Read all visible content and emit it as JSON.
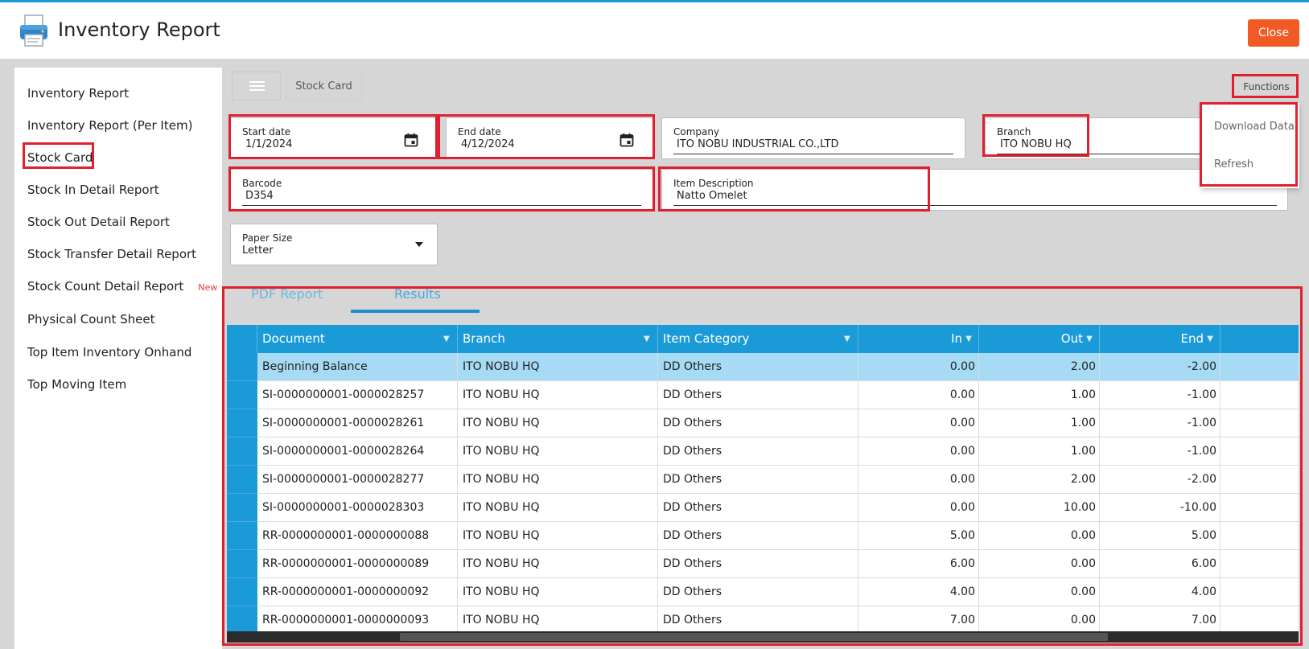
{
  "header": {
    "title": "Inventory Report",
    "close_label": "Close"
  },
  "sidebar": {
    "items": [
      {
        "label": "Inventory Report"
      },
      {
        "label": "Inventory Report (Per Item)"
      },
      {
        "label": "Stock Card"
      },
      {
        "label": "Stock In Detail Report"
      },
      {
        "label": "Stock Out Detail Report"
      },
      {
        "label": "Stock Transfer Detail Report"
      },
      {
        "label": "Stock Count Detail Report",
        "badge": "New"
      },
      {
        "label": "Physical Count Sheet"
      },
      {
        "label": "Top Item Inventory Onhand"
      },
      {
        "label": "Top Moving Item"
      }
    ]
  },
  "toolbar": {
    "breadcrumb": "Stock Card",
    "functions_label": "Functions"
  },
  "functions_menu": {
    "download": "Download Data",
    "refresh": "Refresh"
  },
  "form": {
    "start_date": {
      "label": "Start date",
      "value": "1/1/2024"
    },
    "end_date": {
      "label": "End date",
      "value": "4/12/2024"
    },
    "company": {
      "label": "Company",
      "value": "ITO NOBU INDUSTRIAL CO.,LTD"
    },
    "branch": {
      "label": "Branch",
      "value": "ITO NOBU HQ"
    },
    "barcode": {
      "label": "Barcode",
      "value": "D354"
    },
    "item_description": {
      "label": "Item Description",
      "value": "Natto Omelet"
    },
    "paper_size": {
      "label": "Paper Size",
      "value": "Letter"
    }
  },
  "tabs": [
    {
      "label": "PDF Report"
    },
    {
      "label": "Results"
    }
  ],
  "table": {
    "columns": [
      "Document",
      "Branch",
      "Item Category",
      "In",
      "Out",
      "End"
    ],
    "rows": [
      [
        "Beginning Balance",
        "ITO NOBU HQ",
        "DD Others",
        "0.00",
        "2.00",
        "-2.00"
      ],
      [
        "SI-0000000001-0000028257",
        "ITO NOBU HQ",
        "DD Others",
        "0.00",
        "1.00",
        "-1.00"
      ],
      [
        "SI-0000000001-0000028261",
        "ITO NOBU HQ",
        "DD Others",
        "0.00",
        "1.00",
        "-1.00"
      ],
      [
        "SI-0000000001-0000028264",
        "ITO NOBU HQ",
        "DD Others",
        "0.00",
        "1.00",
        "-1.00"
      ],
      [
        "SI-0000000001-0000028277",
        "ITO NOBU HQ",
        "DD Others",
        "0.00",
        "2.00",
        "-2.00"
      ],
      [
        "SI-0000000001-0000028303",
        "ITO NOBU HQ",
        "DD Others",
        "0.00",
        "10.00",
        "-10.00"
      ],
      [
        "RR-0000000001-0000000088",
        "ITO NOBU HQ",
        "DD Others",
        "5.00",
        "0.00",
        "5.00"
      ],
      [
        "RR-0000000001-0000000089",
        "ITO NOBU HQ",
        "DD Others",
        "6.00",
        "0.00",
        "6.00"
      ],
      [
        "RR-0000000001-0000000092",
        "ITO NOBU HQ",
        "DD Others",
        "4.00",
        "0.00",
        "4.00"
      ],
      [
        "RR-0000000001-0000000093",
        "ITO NOBU HQ",
        "DD Others",
        "7.00",
        "0.00",
        "7.00"
      ]
    ]
  },
  "colors": {
    "accent": "#1a9bd8",
    "close": "#f15a24",
    "highlight": "#e0202e",
    "selected_row": "#a6daf5"
  }
}
